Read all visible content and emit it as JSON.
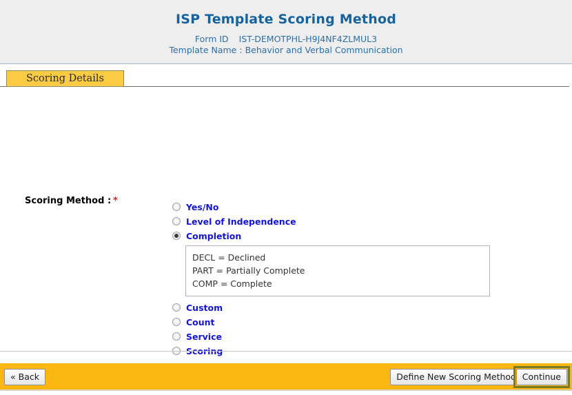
{
  "header": {
    "title": "ISP Template Scoring Method",
    "form_id_label": "Form ID",
    "form_id_value": "IST-DEMOTPHL-H9J4NF4ZLMUL3",
    "template_name_label": "Template Name",
    "template_name_separator": ":",
    "template_name_value": "Behavior and Verbal Communication"
  },
  "section": {
    "tab_label": "Scoring Details"
  },
  "form": {
    "field_label": "Scoring Method :",
    "required_marker": "*",
    "options": [
      {
        "label": "Yes/No",
        "selected": false
      },
      {
        "label": "Level of Independence",
        "selected": false
      },
      {
        "label": "Completion",
        "selected": true
      },
      {
        "label": "Custom",
        "selected": false
      },
      {
        "label": "Count",
        "selected": false
      },
      {
        "label": "Service",
        "selected": false
      },
      {
        "label": "Scoring",
        "selected": false
      }
    ],
    "completion_legend": [
      "DECL = Declined",
      "PART = Partially Complete",
      "COMP = Complete"
    ]
  },
  "footer": {
    "back_label": "« Back",
    "define_label": "Define New Scoring Method",
    "continue_label": "Continue"
  },
  "colors": {
    "title_blue": "#15639e",
    "meta_blue": "#2d6ea8",
    "option_blue": "#1414d6",
    "tab_gold": "#fbcb43",
    "footer_gold": "#fcb713",
    "required_red": "#e01b1b",
    "focus_olive": "#7a7a22"
  }
}
